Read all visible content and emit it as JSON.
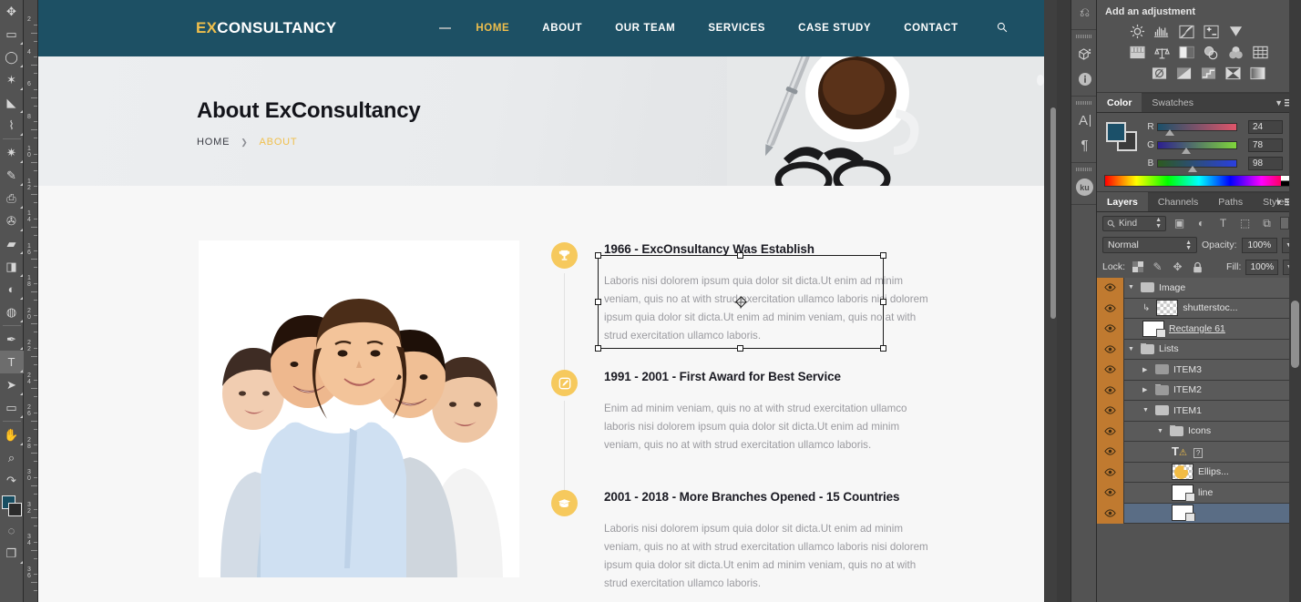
{
  "app": {
    "name": "Adobe Photoshop"
  },
  "toolbar": {
    "tools": [
      {
        "name": "move-tool",
        "glyph": "✥"
      },
      {
        "name": "rectangular-marquee-tool",
        "glyph": "▭"
      },
      {
        "name": "lasso-tool",
        "glyph": "◯"
      },
      {
        "name": "magic-wand-tool",
        "glyph": "✶"
      },
      {
        "name": "crop-tool",
        "glyph": "⌗"
      },
      {
        "name": "eyedropper-tool",
        "glyph": "⌇"
      },
      {
        "name": "spot-healing-brush-tool",
        "glyph": "✷"
      },
      {
        "name": "brush-tool",
        "glyph": "✎"
      },
      {
        "name": "clone-stamp-tool",
        "glyph": "⎙"
      },
      {
        "name": "history-brush-tool",
        "glyph": "✇"
      },
      {
        "name": "eraser-tool",
        "glyph": "▰"
      },
      {
        "name": "gradient-tool",
        "glyph": "◨"
      },
      {
        "name": "blur-tool",
        "glyph": "💧"
      },
      {
        "name": "dodge-tool",
        "glyph": "🔍"
      },
      {
        "name": "pen-tool",
        "glyph": "✒"
      },
      {
        "name": "horizontal-type-tool",
        "glyph": "T"
      },
      {
        "name": "path-selection-tool",
        "glyph": "➤"
      },
      {
        "name": "rectangle-tool",
        "glyph": "▭"
      },
      {
        "name": "hand-tool",
        "glyph": "✋"
      },
      {
        "name": "zoom-tool",
        "glyph": "🔍"
      },
      {
        "name": "rotate-view-tool",
        "glyph": "↺"
      }
    ],
    "foreground_color": "#184e62",
    "background_color": "#2b2b2b",
    "quick-mask-glyph": "◌",
    "screen-mode-glyph": "❐"
  },
  "ruler": {
    "unit_labels": [
      "2",
      "4",
      "6",
      "8",
      "10",
      "12",
      "14",
      "16",
      "18",
      "20",
      "22",
      "24",
      "26",
      "28",
      "30",
      "32",
      "34",
      "36"
    ]
  },
  "website": {
    "logo": {
      "accent": "EX",
      "rest": "CONSULTANCY"
    },
    "nav": [
      {
        "label": "HOME",
        "active": true
      },
      {
        "label": "ABOUT",
        "active": false
      },
      {
        "label": "OUR TEAM",
        "active": false
      },
      {
        "label": "SERVICES",
        "active": false
      },
      {
        "label": "CASE STUDY",
        "active": false
      },
      {
        "label": "CONTACT",
        "active": false
      }
    ],
    "search_icon": "search-icon",
    "hero": {
      "title": "About ExConsultancy",
      "breadcrumb_home": "HOME",
      "breadcrumb_sep": "❯",
      "breadcrumb_current": "ABOUT"
    },
    "timeline": [
      {
        "icon": "trophy-icon",
        "glyph": "🏆",
        "heading": "1966 - ExcOnsultancy Was Establish",
        "body": "Laboris nisi dolorem ipsum quia dolor sit dicta.Ut enim ad minim veniam, quis no at with strud exercitation ullamco laboris nisi dolorem ipsum quia dolor sit dicta.Ut enim ad minim veniam, quis no at with strud exercitation ullamco laboris."
      },
      {
        "icon": "edit-badge-icon",
        "glyph": "✎",
        "heading": "1991 - 2001 - First Award for Best Service",
        "body": "Enim ad minim veniam, quis no at with strud exercitation ullamco laboris nisi dolorem ipsum quia dolor sit dicta.Ut enim ad minim veniam, quis no at with strud exercitation ullamco laboris."
      },
      {
        "icon": "graduation-cap-icon",
        "glyph": "🎓",
        "heading": "2001 - 2018 - More Branches Opened - 15 Countries",
        "body": "Laboris nisi dolorem ipsum quia dolor sit dicta.Ut enim ad minim veniam, quis no at with strud exercitation ullamco laboris nisi dolorem ipsum quia dolor sit dicta.Ut enim ad minim veniam, quis no at with strud exercitation ullamco laboris."
      }
    ],
    "colors": {
      "header_bg": "#1d5064",
      "accent": "#f0bf4c",
      "badge": "#f6c95d",
      "body_bg": "#f7f7f7"
    }
  },
  "dock": {
    "items": [
      {
        "name": "mini-bridge-icon",
        "glyph": "⬓"
      },
      {
        "name": "info-icon",
        "glyph": "ⓘ"
      },
      {
        "name": "character-panel-icon",
        "glyph": "A"
      },
      {
        "name": "paragraph-panel-icon",
        "glyph": "¶"
      },
      {
        "name": "kuler-panel-icon",
        "glyph": "ku"
      }
    ]
  },
  "adjustments": {
    "title": "Add an adjustment",
    "rows": [
      [
        {
          "name": "brightness-contrast-icon",
          "glyph": "☀"
        },
        {
          "name": "levels-icon",
          "glyph": "▥"
        },
        {
          "name": "curves-icon",
          "glyph": "◸"
        },
        {
          "name": "exposure-icon",
          "glyph": "±"
        },
        {
          "name": "vibrance-icon",
          "glyph": "▽"
        }
      ],
      [
        {
          "name": "hue-saturation-icon",
          "glyph": "▦"
        },
        {
          "name": "color-balance-icon",
          "glyph": "⚖"
        },
        {
          "name": "black-and-white-icon",
          "glyph": "◧"
        },
        {
          "name": "photo-filter-icon",
          "glyph": "◓"
        },
        {
          "name": "channel-mixer-icon",
          "glyph": "❀"
        },
        {
          "name": "color-lookup-icon",
          "glyph": "⊞"
        }
      ],
      [
        {
          "name": "invert-icon",
          "glyph": "◍"
        },
        {
          "name": "posterize-icon",
          "glyph": "◩"
        },
        {
          "name": "threshold-icon",
          "glyph": "◿"
        },
        {
          "name": "gradient-map-icon",
          "glyph": "⧖"
        },
        {
          "name": "selective-color-icon",
          "glyph": "▤"
        }
      ]
    ]
  },
  "color_panel": {
    "tabs": [
      {
        "label": "Color",
        "active": true
      },
      {
        "label": "Swatches",
        "active": false
      }
    ],
    "channels": [
      {
        "label": "R",
        "value": "24"
      },
      {
        "label": "G",
        "value": "78"
      },
      {
        "label": "B",
        "value": "98"
      }
    ],
    "foreground": "#1b5069",
    "background": "#3b3b3b"
  },
  "layers_panel": {
    "tabs": [
      {
        "label": "Layers",
        "active": true
      },
      {
        "label": "Channels",
        "active": false
      },
      {
        "label": "Paths",
        "active": false
      },
      {
        "label": "Styles",
        "active": false
      }
    ],
    "filter_label": "Kind",
    "filter_icons": [
      {
        "name": "filter-pixel-icon",
        "glyph": "▣"
      },
      {
        "name": "filter-adjustment-icon",
        "glyph": "◐"
      },
      {
        "name": "filter-type-icon",
        "glyph": "T"
      },
      {
        "name": "filter-shape-icon",
        "glyph": "⬚"
      },
      {
        "name": "filter-smart-object-icon",
        "glyph": "⧉"
      }
    ],
    "blend_mode": "Normal",
    "opacity_label": "Opacity:",
    "opacity_value": "100%",
    "lock_label": "Lock:",
    "lock_icons": [
      {
        "name": "lock-transparent-pixels-icon",
        "glyph": "▨"
      },
      {
        "name": "lock-image-pixels-icon",
        "glyph": "✎"
      },
      {
        "name": "lock-position-icon",
        "glyph": "✥"
      },
      {
        "name": "lock-all-icon",
        "glyph": "🔒"
      }
    ],
    "fill_label": "Fill:",
    "fill_value": "100%",
    "layers": [
      {
        "name": "Image",
        "type": "group",
        "expanded": true,
        "indent": 0,
        "selected": false
      },
      {
        "name": "shutterstoc...",
        "type": "clipped-image",
        "indent": 1,
        "selected": false
      },
      {
        "name": "Rectangle 61",
        "type": "shape",
        "indent": 1,
        "selected": false,
        "underline": true
      },
      {
        "name": "Lists",
        "type": "group",
        "expanded": true,
        "indent": 0,
        "selected": false
      },
      {
        "name": "ITEM3",
        "type": "group",
        "expanded": false,
        "indent": 1,
        "selected": false
      },
      {
        "name": "ITEM2",
        "type": "group",
        "expanded": false,
        "indent": 1,
        "selected": false
      },
      {
        "name": "ITEM1",
        "type": "group",
        "expanded": true,
        "indent": 1,
        "selected": false
      },
      {
        "name": "Icons",
        "type": "group",
        "expanded": true,
        "indent": 2,
        "selected": false
      },
      {
        "name": "",
        "type": "type-warning",
        "indent": 3,
        "selected": false
      },
      {
        "name": "Ellips...",
        "type": "ellipse",
        "indent": 3,
        "selected": false
      },
      {
        "name": "line",
        "type": "shape",
        "indent": 3,
        "selected": false
      },
      {
        "name": "",
        "type": "shape",
        "indent": 3,
        "selected": true
      }
    ]
  }
}
